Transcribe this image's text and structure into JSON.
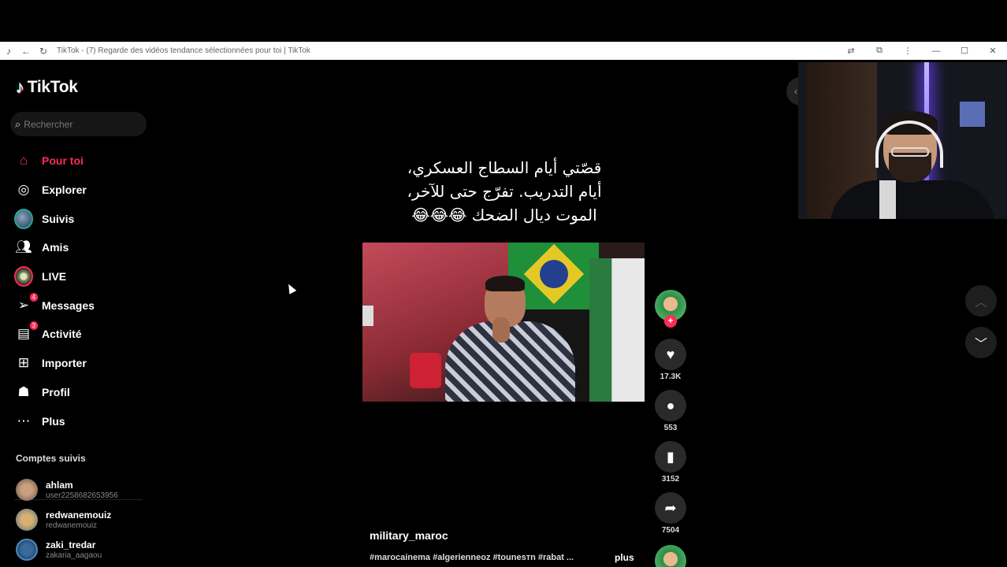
{
  "browser": {
    "title": "TikTok - (7) Regarde des vidéos tendance sélectionnées pour toi | TikTok"
  },
  "sidebar": {
    "logo": "TikTok",
    "search_placeholder": "Rechercher",
    "nav": [
      {
        "label": "Pour toi",
        "icon": "home-icon",
        "active": true
      },
      {
        "label": "Explorer",
        "icon": "compass-icon"
      },
      {
        "label": "Suivis",
        "icon": "following-avatar-icon"
      },
      {
        "label": "Amis",
        "icon": "friends-icon"
      },
      {
        "label": "LIVE",
        "icon": "live-icon"
      },
      {
        "label": "Messages",
        "icon": "messages-icon",
        "badge": "4"
      },
      {
        "label": "Activité",
        "icon": "activity-icon",
        "badge": "3"
      },
      {
        "label": "Importer",
        "icon": "upload-icon"
      },
      {
        "label": "Profil",
        "icon": "profile-icon"
      },
      {
        "label": "Plus",
        "icon": "more-icon"
      }
    ],
    "followed_title": "Comptes suivis",
    "followed": [
      {
        "name": "ahlam",
        "handle": "user2258682653956"
      },
      {
        "name": "redwanemouiz",
        "handle": "redwanemouiz"
      },
      {
        "name": "zaki_tredar",
        "handle": "zakaria_aagaou"
      }
    ]
  },
  "video": {
    "caption_lines": [
      "قصّتي أيام السطاج العسكري،",
      "أيام التدريب. تفرّج حتى للآخر،",
      "الموت ديال الضحك 😂😂😂"
    ],
    "username": "military_maroc",
    "hashtags": "#marocainema #algerienneoz #tounesтn #rabat ...",
    "more": "plus"
  },
  "actions": {
    "likes": "17.3K",
    "comments": "553",
    "saves": "3152",
    "shares": "7504"
  },
  "colors": {
    "accent": "#fe2c55",
    "background": "#000000"
  }
}
